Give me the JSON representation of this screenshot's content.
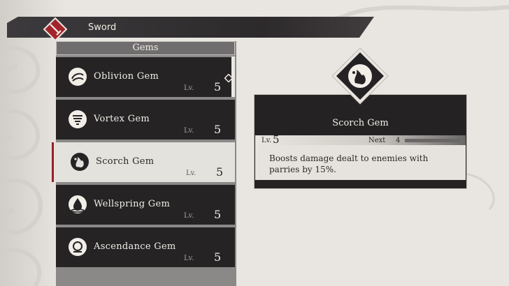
{
  "header": {
    "title": "Sword",
    "icon": "sword-icon",
    "accent": "#a3252c"
  },
  "list": {
    "title": "Gems",
    "lv_label": "Lv.",
    "items": [
      {
        "name": "Oblivion Gem",
        "level": "5",
        "icon": "oblivion-gem-icon"
      },
      {
        "name": "Vortex Gem",
        "level": "5",
        "icon": "vortex-gem-icon"
      },
      {
        "name": "Scorch Gem",
        "level": "5",
        "icon": "scorch-gem-icon",
        "selected": true
      },
      {
        "name": "Wellspring Gem",
        "level": "5",
        "icon": "wellspring-gem-icon"
      },
      {
        "name": "Ascendance Gem",
        "level": "5",
        "icon": "ascendance-gem-icon"
      }
    ]
  },
  "detail": {
    "name": "Scorch Gem",
    "icon": "scorch-gem-icon",
    "lv_label": "Lv.",
    "level": "5",
    "next_label": "Next",
    "next_value": "4",
    "exp_progress": 0,
    "description": "Boosts damage dealt to enemies with parries by 15%."
  },
  "colors": {
    "selected_marker": "#9a1f28",
    "row_bg": "#252324",
    "selected_bg": "#e4e2dd"
  }
}
